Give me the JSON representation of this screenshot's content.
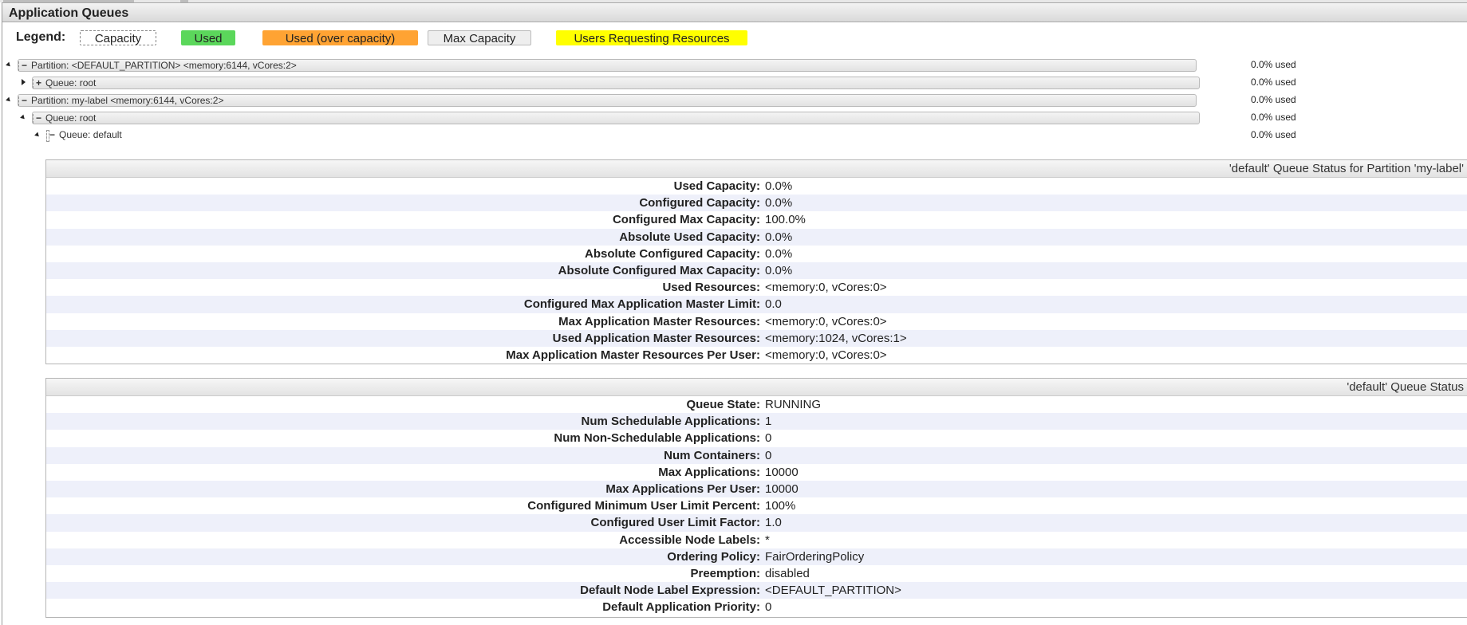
{
  "header": {
    "title": "Application Queues"
  },
  "legend": {
    "label": "Legend:",
    "items": [
      {
        "label": "Capacity"
      },
      {
        "label": "Used",
        "color": "#5bd75b"
      },
      {
        "label": "Used (over capacity)",
        "color": "#ffa333"
      },
      {
        "label": "Max Capacity",
        "color": "#eeeeee"
      },
      {
        "label": "Users Requesting Resources",
        "color": "#ffff00"
      }
    ]
  },
  "tree": [
    {
      "symbol": "−",
      "label": "Partition: <DEFAULT_PARTITION> <memory:6144, vCores:2>",
      "used": "0.0% used",
      "expanded": true
    },
    {
      "symbol": "+",
      "label": "Queue: root",
      "used": "0.0% used",
      "expanded": false
    },
    {
      "symbol": "−",
      "label": "Partition: my-label <memory:6144, vCores:2>",
      "used": "0.0% used",
      "expanded": true
    },
    {
      "symbol": "−",
      "label": "Queue: root",
      "used": "0.0% used",
      "expanded": true
    },
    {
      "symbol": "−",
      "label": "Queue: default",
      "used": "0.0% used",
      "expanded": true
    }
  ],
  "partition_status": {
    "title": "'default' Queue Status for Partition 'my-label'",
    "rows": [
      {
        "key": "Used Capacity:",
        "value": "0.0%"
      },
      {
        "key": "Configured Capacity:",
        "value": "0.0%"
      },
      {
        "key": "Configured Max Capacity:",
        "value": "100.0%"
      },
      {
        "key": "Absolute Used Capacity:",
        "value": "0.0%"
      },
      {
        "key": "Absolute Configured Capacity:",
        "value": "0.0%"
      },
      {
        "key": "Absolute Configured Max Capacity:",
        "value": "0.0%"
      },
      {
        "key": "Used Resources:",
        "value": "<memory:0, vCores:0>"
      },
      {
        "key": "Configured Max Application Master Limit:",
        "value": "0.0"
      },
      {
        "key": "Max Application Master Resources:",
        "value": "<memory:0, vCores:0>"
      },
      {
        "key": "Used Application Master Resources:",
        "value": "<memory:1024, vCores:1>"
      },
      {
        "key": "Max Application Master Resources Per User:",
        "value": "<memory:0, vCores:0>"
      }
    ]
  },
  "queue_status": {
    "title": "'default' Queue Status",
    "rows": [
      {
        "key": "Queue State:",
        "value": "RUNNING"
      },
      {
        "key": "Num Schedulable Applications:",
        "value": "1"
      },
      {
        "key": "Num Non-Schedulable Applications:",
        "value": "0"
      },
      {
        "key": "Num Containers:",
        "value": "0"
      },
      {
        "key": "Max Applications:",
        "value": "10000"
      },
      {
        "key": "Max Applications Per User:",
        "value": "10000"
      },
      {
        "key": "Configured Minimum User Limit Percent:",
        "value": "100%"
      },
      {
        "key": "Configured User Limit Factor:",
        "value": "1.0"
      },
      {
        "key": "Accessible Node Labels:",
        "value": "*"
      },
      {
        "key": "Ordering Policy:",
        "value": "FairOrderingPolicy"
      },
      {
        "key": "Preemption:",
        "value": "disabled"
      },
      {
        "key": "Default Node Label Expression:",
        "value": "<DEFAULT_PARTITION>"
      },
      {
        "key": "Default Application Priority:",
        "value": "0"
      }
    ]
  }
}
